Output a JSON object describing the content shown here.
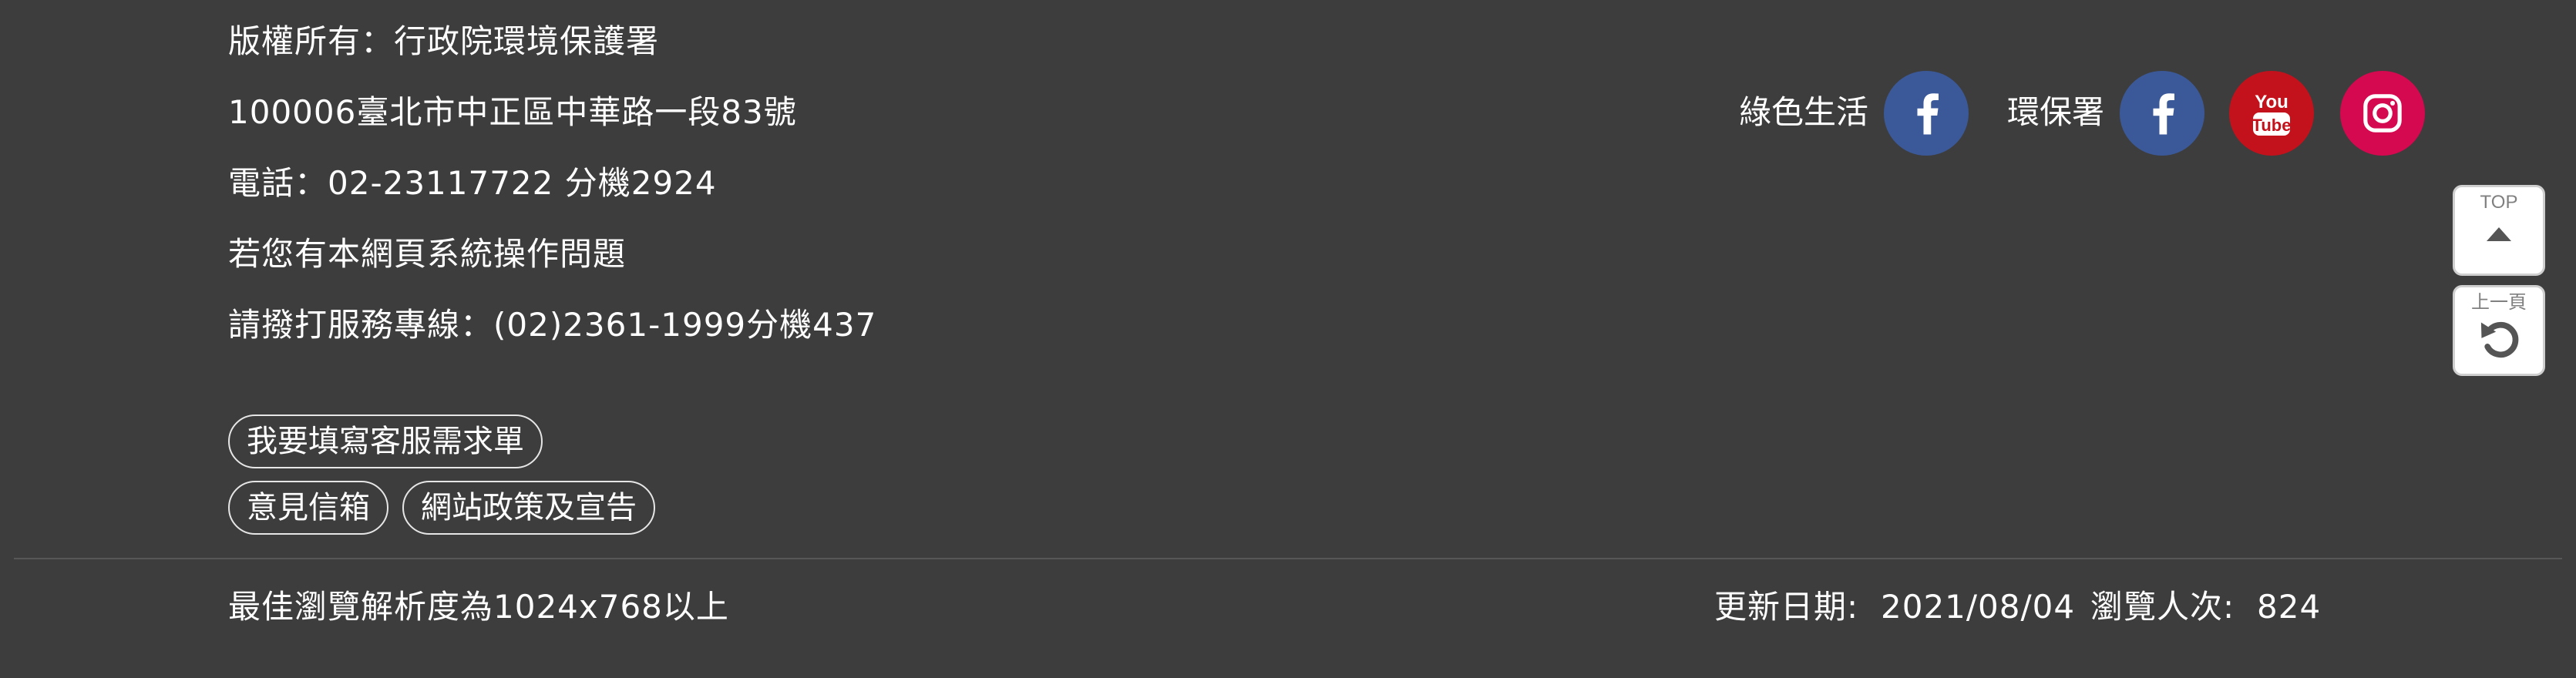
{
  "contact": {
    "copyright": "版權所有：行政院環境保護署",
    "address": "100006臺北市中正區中華路一段83號",
    "phone": "電話：02-23117722 分機2924",
    "help_line1": "若您有本網頁系統操作問題",
    "help_line2": "請撥打服務專線：(02)2361-1999分機437"
  },
  "links": {
    "service_request": "我要填寫客服需求單",
    "feedback_mailbox": "意見信箱",
    "site_policy": "網站政策及宣告"
  },
  "social": {
    "green_life_label": "綠色生活",
    "epa_label": "環保署",
    "facebook_color": "#3b5998",
    "youtube_color": "#c4121c",
    "instagram_color": "#d4094f",
    "icons": [
      "facebook-icon",
      "facebook-icon",
      "youtube-icon",
      "instagram-icon"
    ]
  },
  "floating": {
    "top_label": "TOP",
    "back_label": "上一頁"
  },
  "bottom": {
    "resolution_note": "最佳瀏覽解析度為1024x768以上",
    "update_label": "更新日期:",
    "update_date": "2021/08/04",
    "visits_label": "瀏覽人次:",
    "visits_count": "824"
  },
  "colors": {
    "background": "#3d3d3d",
    "text": "#ffffff",
    "divider": "#575757"
  }
}
